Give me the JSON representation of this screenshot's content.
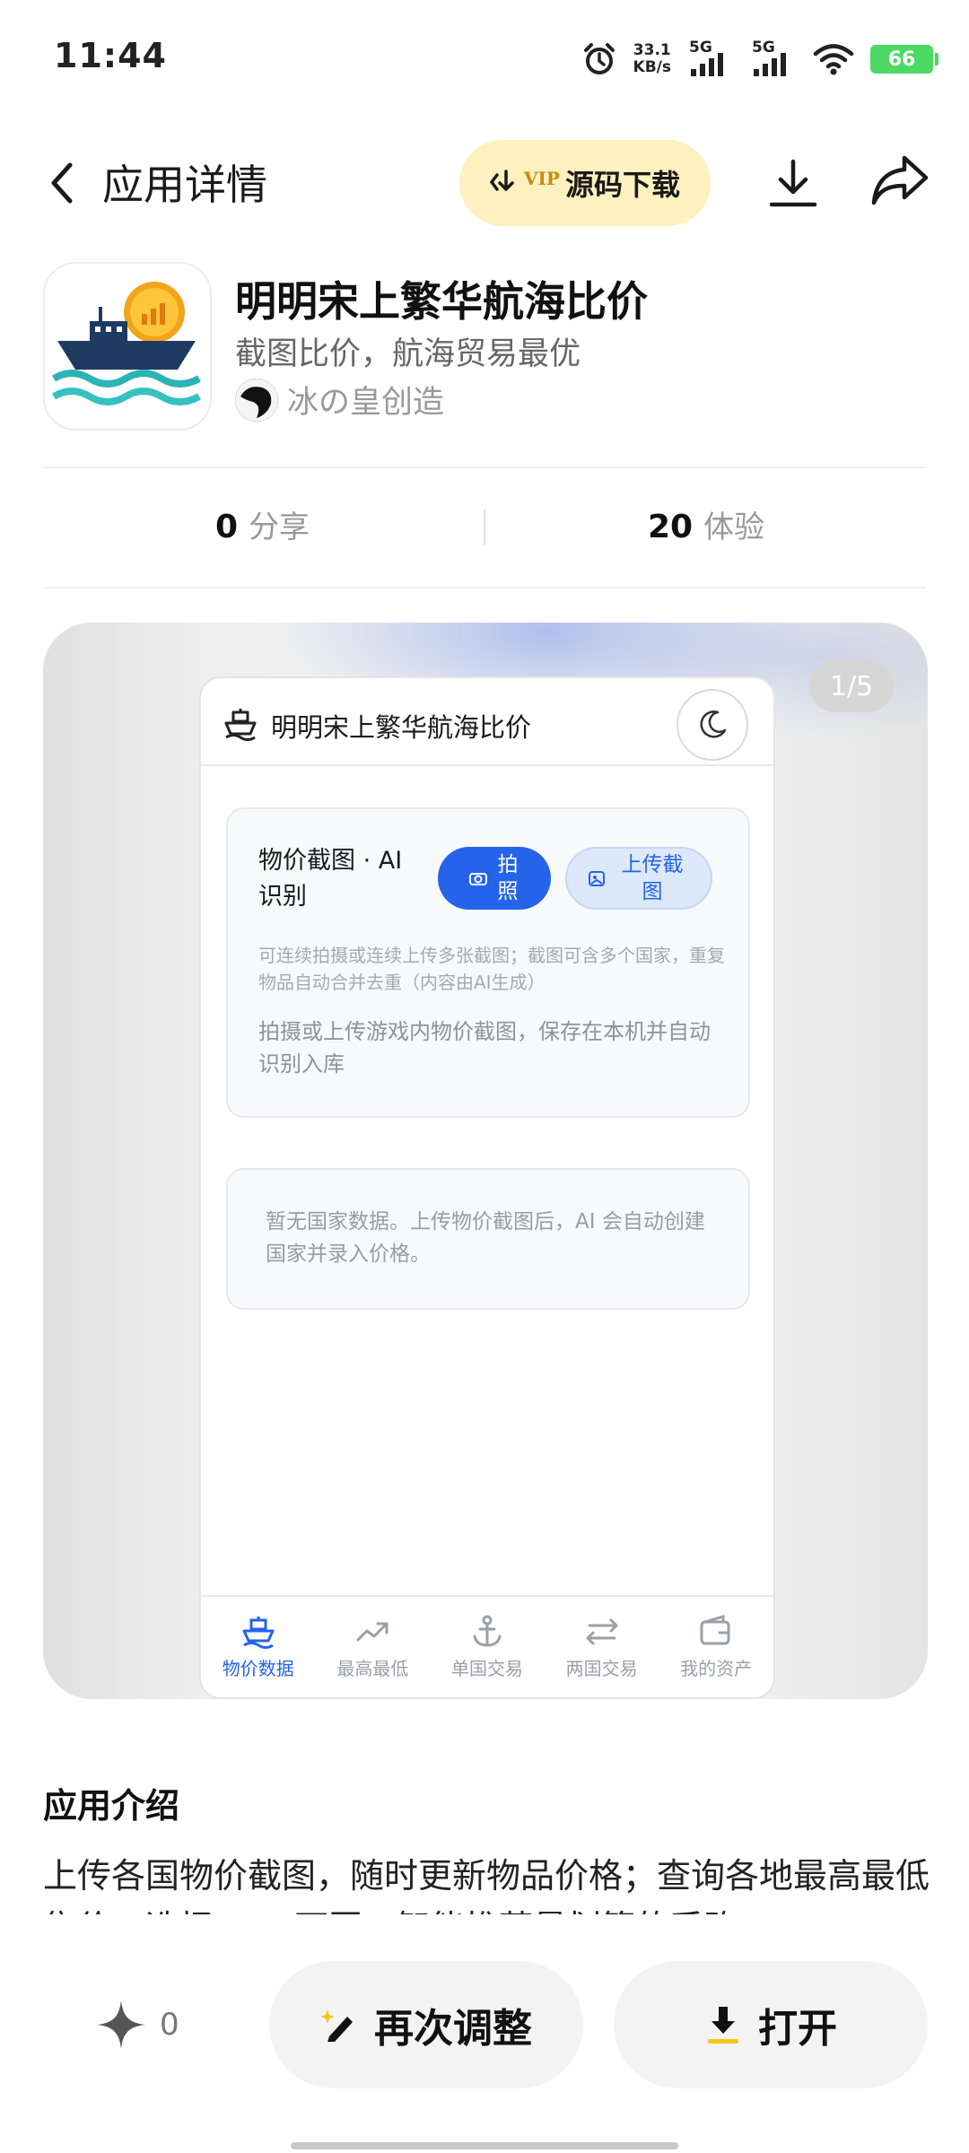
{
  "status_bar": {
    "time": "11:44",
    "net_speed_value": "33.1",
    "net_speed_unit": "KB/s",
    "sim1": "5G",
    "sim2": "5G",
    "battery": "66"
  },
  "header": {
    "title": "应用详情",
    "vip_badge": "VIP",
    "source_download": "源码下载"
  },
  "app": {
    "name": "明明宋上繁华航海比价",
    "description": "截图比价，航海贸易最优",
    "author": "冰の皇创造"
  },
  "stats": {
    "shares_count": "0",
    "shares_label": "分享",
    "experience_count": "20",
    "experience_label": "体验"
  },
  "carousel": {
    "indicator": "1/5",
    "phone": {
      "title": "明明宋上繁华航海比价",
      "card_title": "物价截图 · AI 识别",
      "photo_button": "拍 照",
      "upload_button": "上传截 图",
      "hint_small": "可连续拍摄或连续上传多张截图；截图可含多个国家，重复物品自动合并去重（内容由AI生成）",
      "hint_main": "拍摄或上传游戏内物价截图，保存在本机并自动识别入库",
      "empty_text": "暂无国家数据。上传物价截图后，AI 会自动创建国家并录入价格。",
      "tabs": [
        {
          "label": "物价数据",
          "icon": "ship-icon",
          "active": true
        },
        {
          "label": "最高最低",
          "icon": "trend-icon",
          "active": false
        },
        {
          "label": "单国交易",
          "icon": "anchor-icon",
          "active": false
        },
        {
          "label": "两国交易",
          "icon": "swap-icon",
          "active": false
        },
        {
          "label": "我的资产",
          "icon": "wallet-icon",
          "active": false
        }
      ],
      "accent_color": "#2563eb"
    }
  },
  "intro": {
    "title": "应用介绍",
    "text": "上传各国物价截图，随时更新物品价格；查询各地最高最低售价，选择A、B两国，智能推荐最划算的采购"
  },
  "bottom_bar": {
    "like_count": "0",
    "readjust": "再次调整",
    "open": "打开"
  }
}
